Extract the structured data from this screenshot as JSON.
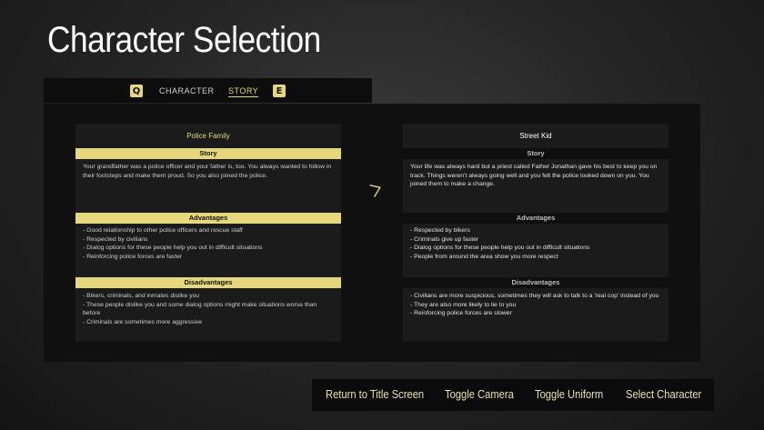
{
  "title": "Character Selection",
  "tabs": {
    "prev_key": "Q",
    "next_key": "E",
    "items": [
      {
        "label": "CHARACTER",
        "active": false
      },
      {
        "label": "STORY",
        "active": true
      }
    ]
  },
  "cards": [
    {
      "name": "Police Family",
      "selected": true,
      "story_heading": "Story",
      "story": "Your grandfather was a police officer and your father is, too. You always wanted to follow in their footsteps and make them proud. So you also joined the police.",
      "advantages_heading": "Advantages",
      "advantages": [
        "- Good relationship to other police officers and rescue staff",
        "- Respected by civilians",
        "- Dialog options for these people help you out in difficult situations",
        "- Reinforcing police forces are faster"
      ],
      "disadvantages_heading": "Disadvantages",
      "disadvantages": [
        "- Bikers, criminals, and inmates dislike  you",
        "- These people dislike you and some dialog options might make situations worse than before",
        "- Criminals are sometimes more aggressive"
      ]
    },
    {
      "name": "Street Kid",
      "selected": false,
      "story_heading": "Story",
      "story": "Your life was always hard but a priest called Father Jonathan gave his best to keep you on track. Things weren't always going well and you felt the police looked down on you. You joined them to make a change.",
      "advantages_heading": "Advantages",
      "advantages": [
        "- Respected by bikers",
        "- Criminals give up faster",
        "- Dialog options for these people help you out in difficult situations",
        "- People from around the area show you more respect"
      ],
      "disadvantages_heading": "Disadvantages",
      "disadvantages": [
        "- Civilians are more suspicious, sometimes they will ask to talk to a 'real cop' instead of you",
        "- They are also more likely to lie to you",
        "- Reinforcing police forces are slower"
      ]
    }
  ],
  "actions": {
    "return_label": "Return to Title Screen",
    "camera_label": "Toggle Camera",
    "uniform_label": "Toggle Uniform",
    "select_label": "Select Character"
  },
  "colors": {
    "accent": "#e6d77d",
    "panel": "#101010",
    "card": "#1b1b1b"
  },
  "icons": {
    "cursor": "mouse-cursor-icon"
  }
}
